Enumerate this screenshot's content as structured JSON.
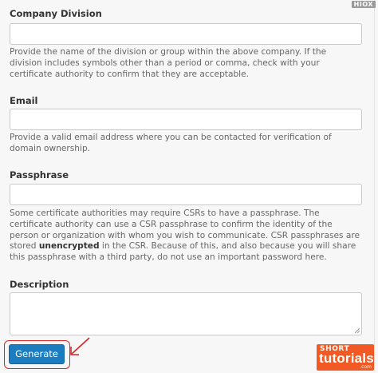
{
  "watermark": "HIOX",
  "fields": {
    "company_division": {
      "label": "Company Division",
      "help": "Provide the name of the division or group within the above company. If the division includes symbols other than a period or comma, check with your certificate authority to confirm that they are acceptable."
    },
    "email": {
      "label": "Email",
      "help": "Provide a valid email address where you can be contacted for verification of domain ownership."
    },
    "passphrase": {
      "label": "Passphrase",
      "help_before": "Some certificate authorities may require CSRs to have a passphrase. The certificate authority can use a CSR passphrase to confirm the identity of the person or organization with whom you wish to communicate. CSR passphrases are stored ",
      "help_bold": "unencrypted",
      "help_after": " in the CSR. Because of this, and also because you will share this passphrase with a third party, do not use an important password here."
    },
    "description": {
      "label": "Description"
    }
  },
  "actions": {
    "generate_label": "Generate"
  },
  "brand": {
    "top": "SHORT",
    "main": "tutorials",
    "sub": ".com"
  },
  "colors": {
    "primary_button": "#1b7dbf",
    "highlight": "#d62727",
    "brand": "#f15a24"
  }
}
